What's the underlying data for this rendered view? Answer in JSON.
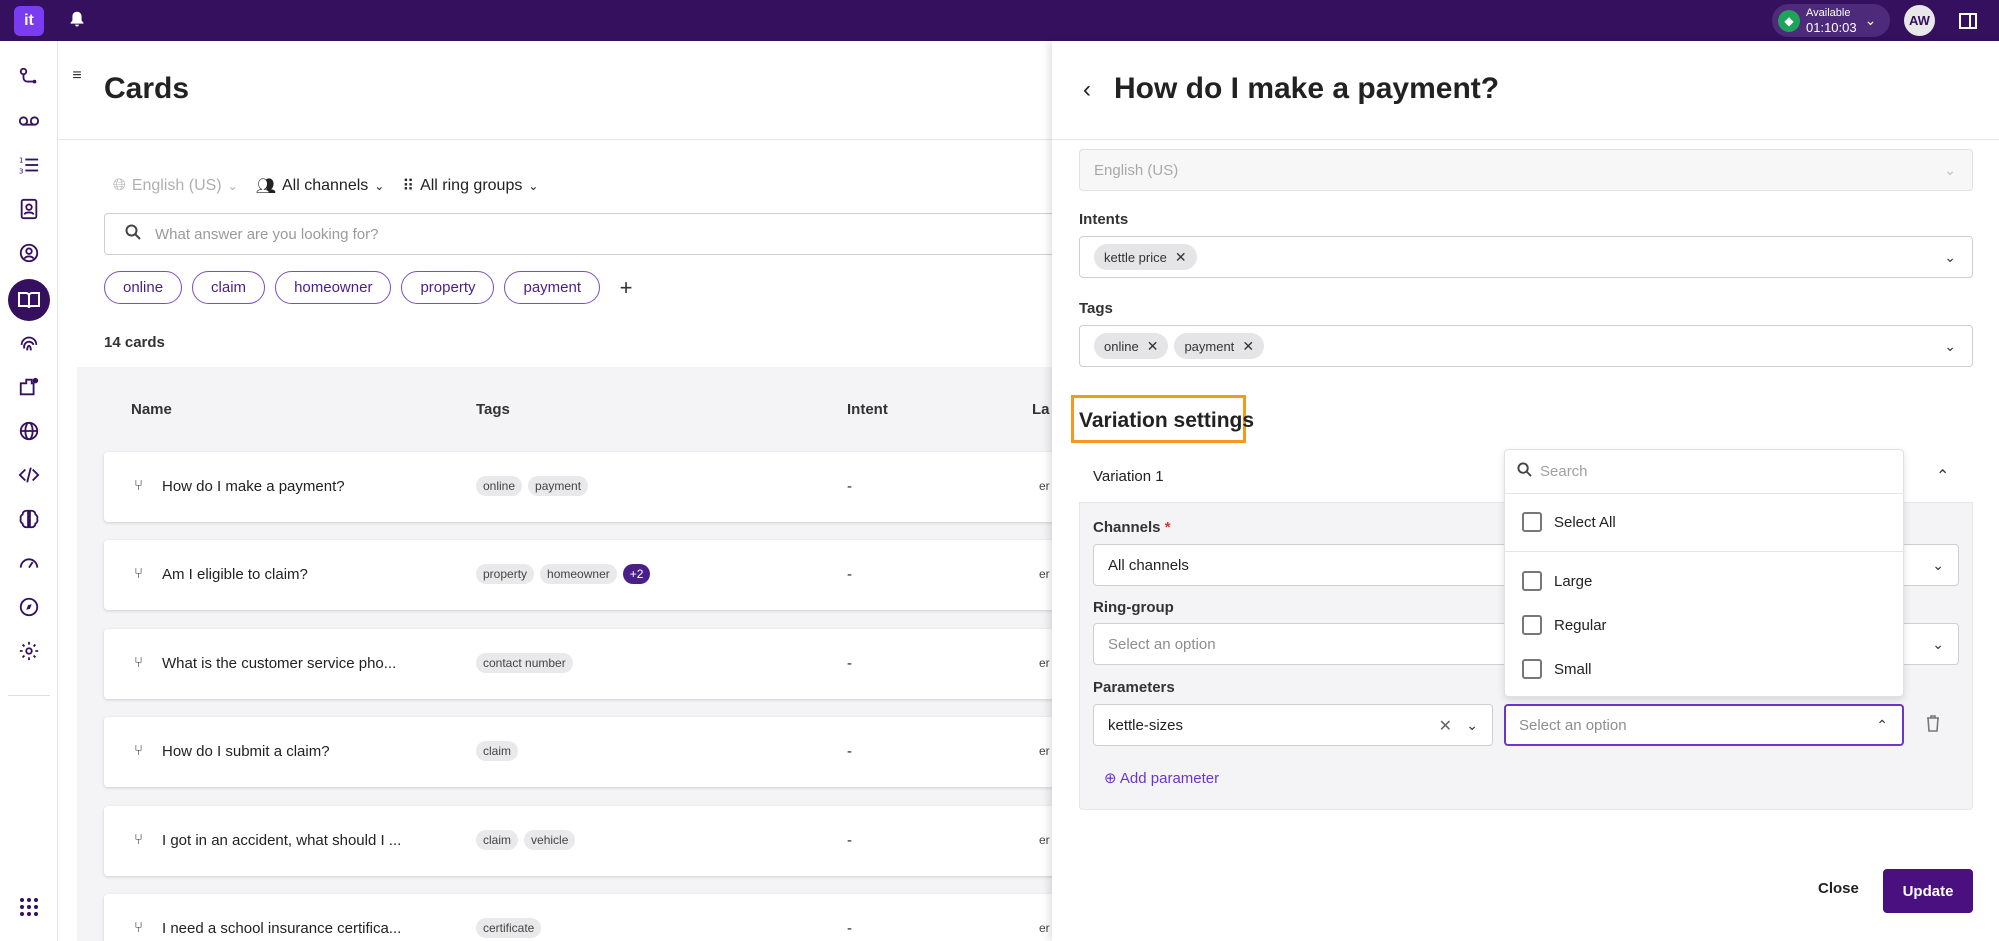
{
  "app": {
    "logo_text": "it"
  },
  "topbar": {
    "status_label": "Available",
    "status_time": "01:10:03",
    "avatar_initials": "AW"
  },
  "nav": {
    "icons": [
      "route-icon",
      "voicemail-icon",
      "list-icon",
      "contacts-icon",
      "agent-icon",
      "knowledge-book-icon",
      "fingerprint-icon",
      "integrations-icon",
      "globe-icon",
      "code-icon",
      "brain-icon",
      "dashboard-gauge-icon",
      "compass-icon",
      "settings-gear-icon"
    ],
    "active": "knowledge-book-icon"
  },
  "page": {
    "title": "Cards",
    "filters": {
      "language": "English (US)",
      "channels": "All channels",
      "ring_groups": "All ring groups"
    },
    "search_placeholder": "What answer are you looking for?",
    "tag_chips": [
      "online",
      "claim",
      "homeowner",
      "property",
      "payment"
    ],
    "add_chip": "+",
    "count_label": "14 cards",
    "columns": [
      "Name",
      "Tags",
      "Intent",
      "La"
    ],
    "rows": [
      {
        "name": "How do I make a payment?",
        "tags": [
          "online",
          "payment"
        ],
        "intent": "-",
        "lang": "er"
      },
      {
        "name": "Am I eligible to claim?",
        "tags": [
          "property",
          "homeowner",
          "+2"
        ],
        "intent": "-",
        "lang": "er"
      },
      {
        "name": "What is the customer service pho...",
        "tags": [
          "contact number"
        ],
        "intent": "-",
        "lang": "er"
      },
      {
        "name": "How do I submit a claim?",
        "tags": [
          "claim"
        ],
        "intent": "-",
        "lang": "er"
      },
      {
        "name": "I got in an accident, what should I ...",
        "tags": [
          "claim",
          "vehicle"
        ],
        "intent": "-",
        "lang": "er"
      },
      {
        "name": "I need a school insurance certifica...",
        "tags": [
          "certificate"
        ],
        "intent": "-",
        "lang": "er"
      }
    ]
  },
  "panel": {
    "title": "How do I make a payment?",
    "language_value": "English (US)",
    "intents_label": "Intents",
    "intents": [
      "kettle price"
    ],
    "tags_label": "Tags",
    "tags": [
      "online",
      "payment"
    ],
    "variation_settings_label": "Variation settings",
    "variation_name": "Variation 1",
    "channels_label": "Channels",
    "channels_required": "*",
    "channels_value": "All channels",
    "ring_group_label": "Ring-group",
    "ring_group_placeholder": "Select an option",
    "parameters_label": "Parameters",
    "parameter_name": "kettle-sizes",
    "parameter_value_placeholder": "Select an option",
    "add_parameter": "Add parameter",
    "dropdown": {
      "search_placeholder": "Search",
      "select_all": "Select All",
      "options": [
        "Large",
        "Regular",
        "Small"
      ]
    },
    "close_label": "Close",
    "update_label": "Update"
  }
}
